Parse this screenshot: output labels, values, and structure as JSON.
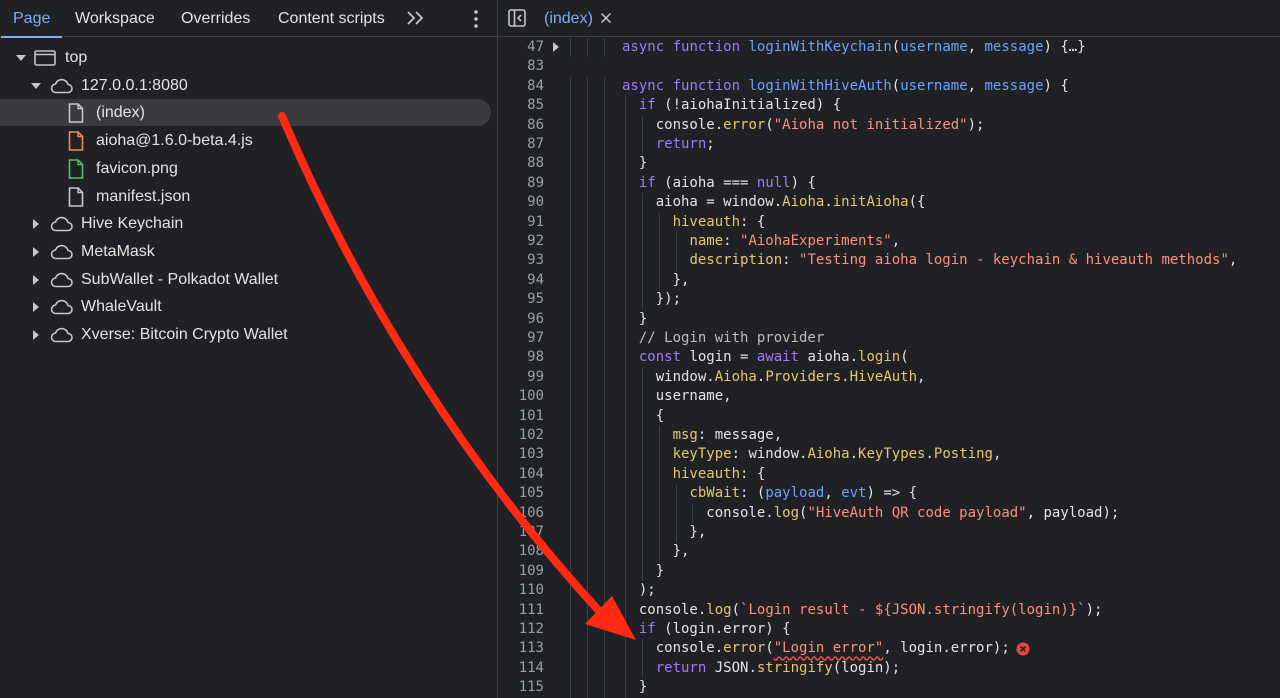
{
  "navigator": {
    "tabs": [
      "Page",
      "Workspace",
      "Overrides",
      "Content scripts"
    ],
    "active_tab": "Page",
    "more_tabs_icon": "chevron-double-right-icon",
    "menu_icon": "kebab-menu-icon",
    "tree": [
      {
        "label": "top",
        "icon": "frame-icon",
        "expanded": true
      },
      {
        "label": "127.0.0.1:8080",
        "icon": "cloud-icon",
        "expanded": true
      },
      {
        "label": "(index)",
        "icon": "document-icon",
        "selected": true
      },
      {
        "label": "aioha@1.6.0-beta.4.js",
        "icon": "script-file-icon",
        "color": "#f28b54"
      },
      {
        "label": "favicon.png",
        "icon": "image-file-icon",
        "color": "#5bb974"
      },
      {
        "label": "manifest.json",
        "icon": "document-icon"
      },
      {
        "label": "Hive Keychain",
        "icon": "cloud-icon",
        "expanded": false
      },
      {
        "label": "MetaMask",
        "icon": "cloud-icon",
        "expanded": false
      },
      {
        "label": "SubWallet - Polkadot Wallet",
        "icon": "cloud-icon",
        "expanded": false
      },
      {
        "label": "WhaleVault",
        "icon": "cloud-icon",
        "expanded": false
      },
      {
        "label": "Xverse: Bitcoin Crypto Wallet",
        "icon": "cloud-icon",
        "expanded": false
      }
    ]
  },
  "editor": {
    "tab_label": "(index)",
    "toggle_icon": "sidebar-toggle-icon",
    "close_icon": "close-icon",
    "error_icon": "error-circle-icon",
    "lines": [
      {
        "n": "47",
        "t": "async function loginWithKeychain(username, message) {…}"
      },
      {
        "n": "83",
        "t": ""
      },
      {
        "n": "84",
        "t": "async function loginWithHiveAuth(username, message) {"
      },
      {
        "n": "85",
        "t": "  if (!aiohaInitialized) {"
      },
      {
        "n": "86",
        "t": "    console.error(\"Aioha not initialized\");"
      },
      {
        "n": "87",
        "t": "    return;"
      },
      {
        "n": "88",
        "t": "  }"
      },
      {
        "n": "89",
        "t": "  if (aioha === null) {"
      },
      {
        "n": "90",
        "t": "    aioha = window.Aioha.initAioha({"
      },
      {
        "n": "91",
        "t": "      hiveauth: {"
      },
      {
        "n": "92",
        "t": "        name: \"AiohaExperiments\","
      },
      {
        "n": "93",
        "t": "        description: \"Testing aioha login - keychain & hiveauth methods\","
      },
      {
        "n": "94",
        "t": "      },"
      },
      {
        "n": "95",
        "t": "    });"
      },
      {
        "n": "96",
        "t": "  }"
      },
      {
        "n": "97",
        "t": "  // Login with provider"
      },
      {
        "n": "98",
        "t": "  const login = await aioha.login("
      },
      {
        "n": "99",
        "t": "    window.Aioha.Providers.HiveAuth,"
      },
      {
        "n": "100",
        "t": "    username,"
      },
      {
        "n": "101",
        "t": "    {"
      },
      {
        "n": "102",
        "t": "      msg: message,"
      },
      {
        "n": "103",
        "t": "      keyType: window.Aioha.KeyTypes.Posting,"
      },
      {
        "n": "104",
        "t": "      hiveauth: {"
      },
      {
        "n": "105",
        "t": "        cbWait: (payload, evt) => {"
      },
      {
        "n": "106",
        "t": "          console.log(\"HiveAuth QR code payload\", payload);"
      },
      {
        "n": "107",
        "t": "        },"
      },
      {
        "n": "108",
        "t": "      },"
      },
      {
        "n": "109",
        "t": "    }"
      },
      {
        "n": "110",
        "t": "  );"
      },
      {
        "n": "111",
        "t": "  console.log(`Login result - ${JSON.stringify(login)}`);"
      },
      {
        "n": "112",
        "t": "  if (login.error) {"
      },
      {
        "n": "113",
        "t": "    console.error(\"Login error\", login.error);"
      },
      {
        "n": "114",
        "t": "    return JSON.stringify(login);"
      },
      {
        "n": "115",
        "t": "  }"
      }
    ]
  },
  "annotation": {
    "arrow_color": "#ff2a14"
  }
}
